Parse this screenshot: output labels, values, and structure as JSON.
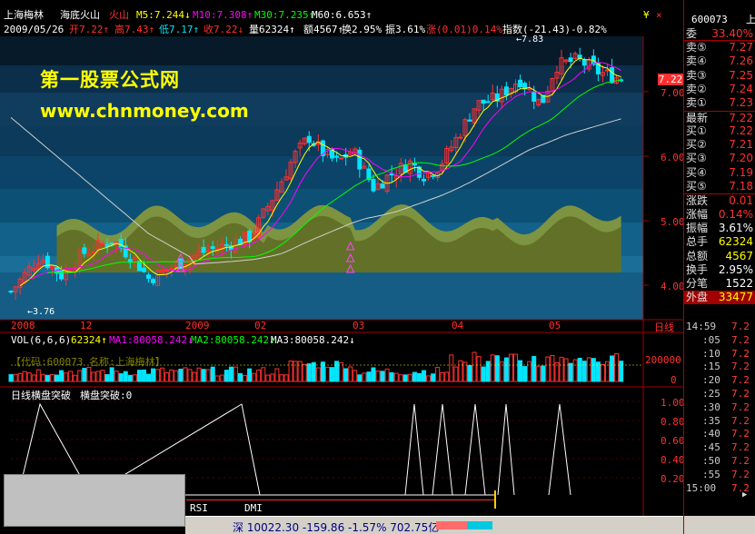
{
  "header": {
    "stock_name": "上海梅林",
    "formula_name": "海底火山",
    "formula_tag": "火山",
    "ma_labels": [
      "M5:7.244↓",
      "M10:7.308↑",
      "M30:7.235↑",
      "M60:6.653↑"
    ],
    "date": "2009/05/26",
    "open": "开7.22↑",
    "high": "高7.43↑",
    "low": "低7.17↑",
    "close": "收7.22↓",
    "volume": "量62324↑",
    "amount": "额4567↑",
    "turnover": "换2.95%",
    "amplitude": "振3.61%",
    "change": "涨(0.01)0.14%",
    "index": "指数(-21.43)-0.82%"
  },
  "watermark": {
    "line1": "第一股票公式网",
    "line2": "www.chnmoney.com"
  },
  "price_axis": {
    "labels": [
      "7.00",
      "6.00",
      "5.00",
      "4.00"
    ],
    "current_tag": "7.22",
    "high_mark": "7.83",
    "low_mark": "3.76"
  },
  "time_axis": {
    "labels": [
      "2008",
      "12",
      "2009",
      "02",
      "03",
      "04",
      "05"
    ],
    "period": "日线"
  },
  "volume_panel": {
    "vol_title": "VOL(6,6,6)",
    "vol_value": "62324↑",
    "ma1": "MA1:80058.242↓",
    "ma2": "MA2:80058.242↓",
    "ma3": "MA3:80058.242↓",
    "code_label": "【代码:600073  名称:上海梅林】",
    "axis_labels": [
      "200000",
      "0"
    ]
  },
  "indicator_panel": {
    "title": "日线横盘突破",
    "value_label": "横盘突破:0",
    "axis_labels": [
      "1.00",
      "0.80",
      "0.60",
      "0.40",
      "0.20"
    ]
  },
  "bottom_tabs": [
    "RSI",
    "DMI"
  ],
  "status_bar": {
    "text": "深 10022.30  -159.86  -1.57%  702.75亿"
  },
  "quote": {
    "code": "600073",
    "name_tag": "上",
    "weibi_label": "委",
    "weibi_value": "33.40%",
    "rows": [
      {
        "label": "卖⑤",
        "value": "7.27"
      },
      {
        "label": "卖④",
        "value": "7.26"
      },
      {
        "label": "卖③",
        "value": "7.25"
      },
      {
        "label": "卖②",
        "value": "7.24"
      },
      {
        "label": "卖①",
        "value": "7.23"
      },
      {
        "label": "最新",
        "value": "7.22"
      },
      {
        "label": "买①",
        "value": "7.22"
      },
      {
        "label": "买②",
        "value": "7.21"
      },
      {
        "label": "买③",
        "value": "7.20"
      },
      {
        "label": "买④",
        "value": "7.19"
      },
      {
        "label": "买⑤",
        "value": "7.18"
      },
      {
        "label": "涨跌",
        "value": "0.01"
      },
      {
        "label": "涨幅",
        "value": "0.14%"
      },
      {
        "label": "振幅",
        "value": "3.61%"
      },
      {
        "label": "总手",
        "value": "62324"
      },
      {
        "label": "总额",
        "value": "4567"
      },
      {
        "label": "换手",
        "value": "2.95%"
      },
      {
        "label": "分笔",
        "value": "1522"
      },
      {
        "label": "外盘",
        "value": "33477"
      }
    ],
    "ticks": [
      {
        "time": "14:59",
        "price": "7.2"
      },
      {
        "time": ":05",
        "price": "7.2"
      },
      {
        "time": ":10",
        "price": "7.2"
      },
      {
        "time": ":15",
        "price": "7.2"
      },
      {
        "time": ":20",
        "price": "7.2"
      },
      {
        "time": ":25",
        "price": "7.2"
      },
      {
        "time": ":30",
        "price": "7.2"
      },
      {
        "time": ":35",
        "price": "7.2"
      },
      {
        "time": ":40",
        "price": "7.2"
      },
      {
        "time": ":45",
        "price": "7.2"
      },
      {
        "time": ":50",
        "price": "7.2"
      },
      {
        "time": ":55",
        "price": "7.2"
      },
      {
        "time": "15:00",
        "price": "7.2"
      }
    ]
  },
  "colors": {
    "up": "#ff3030",
    "down": "#00e5ff",
    "ma5": "#ffffff",
    "ma10": "#ffff00",
    "ma30": "#ff00ff",
    "ma60": "#00ff00",
    "mountain": "#8a9a3a"
  }
}
